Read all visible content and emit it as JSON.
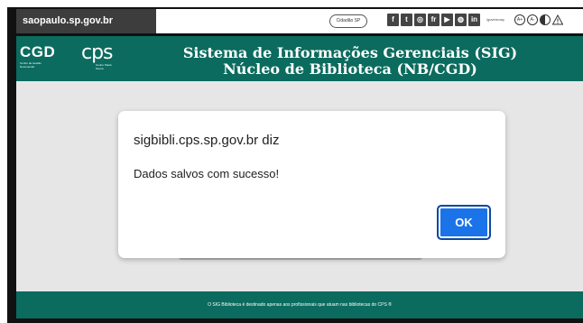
{
  "gov_bar": {
    "domain": "saopaulo.sp.gov.br",
    "cidadao_button": "Cidadão SP",
    "social_icons": [
      {
        "name": "facebook-icon",
        "glyph": "f"
      },
      {
        "name": "twitter-icon",
        "glyph": "t"
      },
      {
        "name": "instagram-icon",
        "glyph": "◎"
      },
      {
        "name": "flickr-icon",
        "glyph": "fr"
      },
      {
        "name": "youtube-icon",
        "glyph": "▶"
      },
      {
        "name": "issuu-icon",
        "glyph": "◍"
      },
      {
        "name": "linkedin-icon",
        "glyph": "in"
      }
    ],
    "handle": "/governosp",
    "accessibility": {
      "increase_font": "A+",
      "decrease_font": "A-"
    }
  },
  "header": {
    "cgd_logo": "CGD",
    "cgd_subtitle": "Centro de Gestão Documental",
    "cps_logo": "cps",
    "cps_subtitle": "Centro Paula Souza",
    "title_line1": "Sistema de Informações Gerenciais (SIG)",
    "title_line2": "Núcleo de Biblioteca (NB/CGD)"
  },
  "dialog": {
    "origin": "sigbibli.cps.sp.gov.br diz",
    "message": "Dados salvos com sucesso!",
    "ok_label": "OK"
  },
  "footer": {
    "text": "O SIG Biblioteca é destinado apenas aos profissionais que atuam nas bibliotecas do CPS ®"
  },
  "colors": {
    "brand_green": "#0b6b5e",
    "ok_blue": "#1a73e8",
    "content_bg": "#e6e6e6"
  }
}
